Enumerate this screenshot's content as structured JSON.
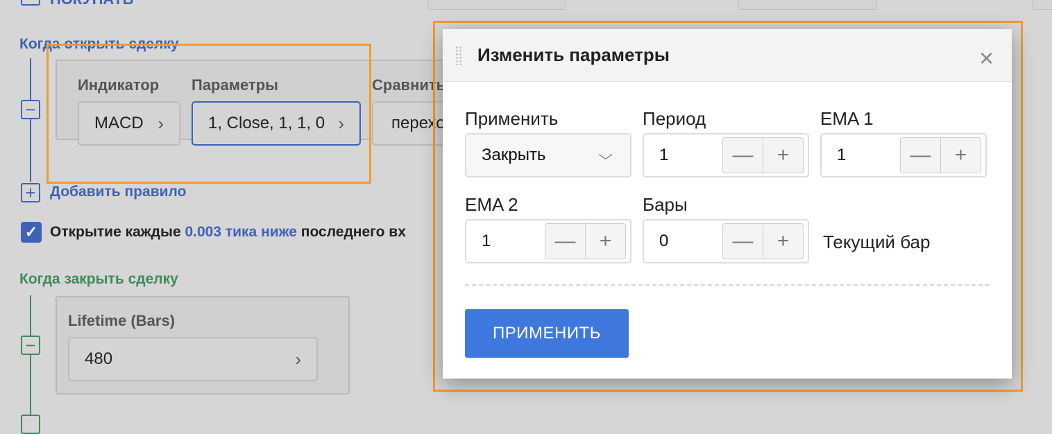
{
  "background": {
    "top_action_label": "ПОКУПАТЬ",
    "entry_section": {
      "title": "Когда открыть сделку",
      "indicator_label": "Индикатор",
      "params_label": "Параметры",
      "compare_label": "Сравнить",
      "indicator_value": "MACD",
      "params_value": "1, Close, 1, 1, 0",
      "compare_value": "перехо",
      "add_rule": "Добавить правило"
    },
    "open_every": {
      "checked": true,
      "prefix": "Открытие каждые ",
      "highlight": "0.003 тика ниже",
      "suffix": " последнего вх"
    },
    "exit_section": {
      "title": "Когда закрыть сделку",
      "lifetime_label": "Lifetime (Bars)",
      "lifetime_value": "480"
    }
  },
  "modal": {
    "title": "Изменить параметры",
    "apply_label": "Применить",
    "apply_value": "Закрыть",
    "period_label": "Период",
    "period_value": "1",
    "ema1_label": "EMA 1",
    "ema1_value": "1",
    "ema2_label": "EMA 2",
    "ema2_value": "1",
    "bars_label": "Бары",
    "bars_value": "0",
    "current_bar_label": "Текущий бар",
    "submit_label": "ПРИМЕНИТЬ"
  },
  "colors": {
    "accent_blue": "#3e62b8",
    "accent_green": "#3f8a5c",
    "highlight_orange": "#ef9b32",
    "primary_button": "#3f78dd"
  }
}
